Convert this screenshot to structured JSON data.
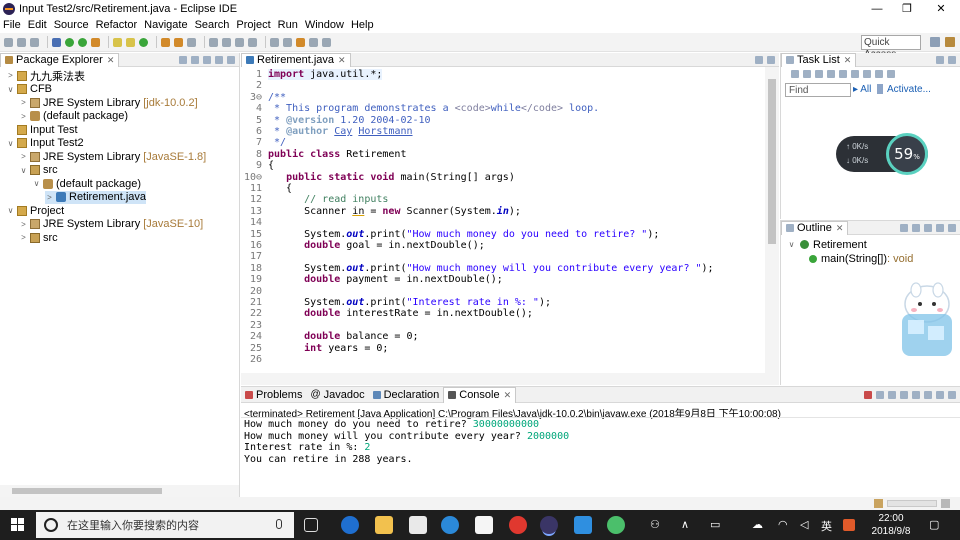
{
  "window": {
    "title": "Input Test2/src/Retirement.java - Eclipse IDE",
    "minimize": "—",
    "maximize": "❐",
    "close": "✕"
  },
  "menu": [
    "File",
    "Edit",
    "Source",
    "Refactor",
    "Navigate",
    "Search",
    "Project",
    "Run",
    "Window",
    "Help"
  ],
  "toolbar": {
    "quick_access": "Quick Access"
  },
  "package_explorer": {
    "tab": "Package Explorer",
    "rows": [
      {
        "label": "九九乘法表",
        "suffix": "",
        "depth": 0,
        "twisty": ">",
        "icon": "project"
      },
      {
        "label": "CFB",
        "suffix": "",
        "depth": 0,
        "twisty": "∨",
        "icon": "project"
      },
      {
        "label": "JRE System Library",
        "suffix": "[jdk-10.0.2]",
        "depth": 1,
        "twisty": ">",
        "icon": "library"
      },
      {
        "label": "(default package)",
        "suffix": "",
        "depth": 1,
        "twisty": ">",
        "icon": "package"
      },
      {
        "label": "Input Test",
        "suffix": "",
        "depth": 0,
        "twisty": "",
        "icon": "project"
      },
      {
        "label": "Input Test2",
        "suffix": "",
        "depth": 0,
        "twisty": "∨",
        "icon": "project"
      },
      {
        "label": "JRE System Library",
        "suffix": "[JavaSE-1.8]",
        "depth": 1,
        "twisty": ">",
        "icon": "library"
      },
      {
        "label": "src",
        "suffix": "",
        "depth": 1,
        "twisty": "∨",
        "icon": "source"
      },
      {
        "label": "(default package)",
        "suffix": "",
        "depth": 2,
        "twisty": "∨",
        "icon": "package"
      },
      {
        "label": "Retirement.java",
        "suffix": "",
        "depth": 3,
        "twisty": ">",
        "icon": "java",
        "selected": true
      },
      {
        "label": "Project",
        "suffix": "",
        "depth": 0,
        "twisty": "∨",
        "icon": "project"
      },
      {
        "label": "JRE System Library",
        "suffix": "[JavaSE-10]",
        "depth": 1,
        "twisty": ">",
        "icon": "library"
      },
      {
        "label": "src",
        "suffix": "",
        "depth": 1,
        "twisty": ">",
        "icon": "source"
      }
    ]
  },
  "editor": {
    "tab": "Retirement.java",
    "lines": [
      {
        "n": "1",
        "html": "<span class=\"kw\">import</span> java.util.*;"
      },
      {
        "n": "2",
        "html": ""
      },
      {
        "n": "3⊖",
        "html": "<span class=\"cm\">/**</span>"
      },
      {
        "n": "4",
        "html": "<span class=\"cm\"> * This program demonstrates a <span class=\"tag\">&lt;code&gt;</span>while<span class=\"tag\">&lt;/code&gt;</span> loop.</span>"
      },
      {
        "n": "5",
        "html": "<span class=\"cm\"> * <b style=\"color:#7f9fbf\">@version</b> 1.20 2004-02-10</span>"
      },
      {
        "n": "6",
        "html": "<span class=\"cm\"> * <b style=\"color:#7f9fbf\">@author</b> <u>Cay</u> <u>Horstmann</u></span>"
      },
      {
        "n": "7",
        "html": "<span class=\"cm\"> */</span>"
      },
      {
        "n": "8",
        "html": "<span class=\"kw\">public class</span> Retirement"
      },
      {
        "n": "9",
        "html": "{"
      },
      {
        "n": "10⊖",
        "html": "   <span class=\"kw\">public static void</span> main(String[] args)"
      },
      {
        "n": "11",
        "html": "   {"
      },
      {
        "n": "12",
        "html": "      <span class=\"cm2\">// read inputs</span>"
      },
      {
        "n": "13",
        "html": "      Scanner <u style=\"text-decoration-color:#d9a100\">in</u> = <span class=\"kw\">new</span> Scanner(System.<span class=\"fi\">in</span>);"
      },
      {
        "n": "14",
        "html": ""
      },
      {
        "n": "15",
        "html": "      System.<span class=\"fi\">out</span>.print(<span class=\"st\">\"How much money do you need to retire? \"</span>);"
      },
      {
        "n": "16",
        "html": "      <span class=\"kw\">double</span> goal = in.nextDouble();"
      },
      {
        "n": "17",
        "html": ""
      },
      {
        "n": "18",
        "html": "      System.<span class=\"fi\">out</span>.print(<span class=\"st\">\"How much money will you contribute every year? \"</span>);"
      },
      {
        "n": "19",
        "html": "      <span class=\"kw\">double</span> payment = in.nextDouble();"
      },
      {
        "n": "20",
        "html": ""
      },
      {
        "n": "21",
        "html": "      System.<span class=\"fi\">out</span>.print(<span class=\"st\">\"Interest rate in %: \"</span>);"
      },
      {
        "n": "22",
        "html": "      <span class=\"kw\">double</span> interestRate = in.nextDouble();"
      },
      {
        "n": "23",
        "html": ""
      },
      {
        "n": "24",
        "html": "      <span class=\"kw\">double</span> balance = 0;"
      },
      {
        "n": "25",
        "html": "      <span class=\"kw\">int</span> years = 0;"
      },
      {
        "n": "26",
        "html": ""
      }
    ]
  },
  "task_list": {
    "tab": "Task List",
    "find_placeholder": "Find",
    "all": "All",
    "activate": "Activate..."
  },
  "net_widget": {
    "up": "0K/s",
    "down": "0K/s",
    "value": "59",
    "unit": "%"
  },
  "outline": {
    "tab": "Outline",
    "class_name": "Retirement",
    "method": "main(String[])",
    "method_type": " : void"
  },
  "bottom_tabs": [
    "Problems",
    "Javadoc",
    "Declaration",
    "Console"
  ],
  "console": {
    "header": "<terminated> Retirement [Java Application] C:\\Program Files\\Java\\jdk-10.0.2\\bin\\javaw.exe (2018年9月8日 下午10:00:08)",
    "lines": [
      {
        "prompt": "How much money do you need to retire? ",
        "input": "30000000000"
      },
      {
        "prompt": "How much money will you contribute every year? ",
        "input": "2000000"
      },
      {
        "prompt": "Interest rate in %: ",
        "input": "2"
      },
      {
        "prompt": "You can retire in 288 years.",
        "input": ""
      }
    ]
  },
  "taskbar": {
    "search_placeholder": "在这里输入你要搜索的内容",
    "ime": "英",
    "time": "22:00",
    "date": "2018/9/8"
  }
}
